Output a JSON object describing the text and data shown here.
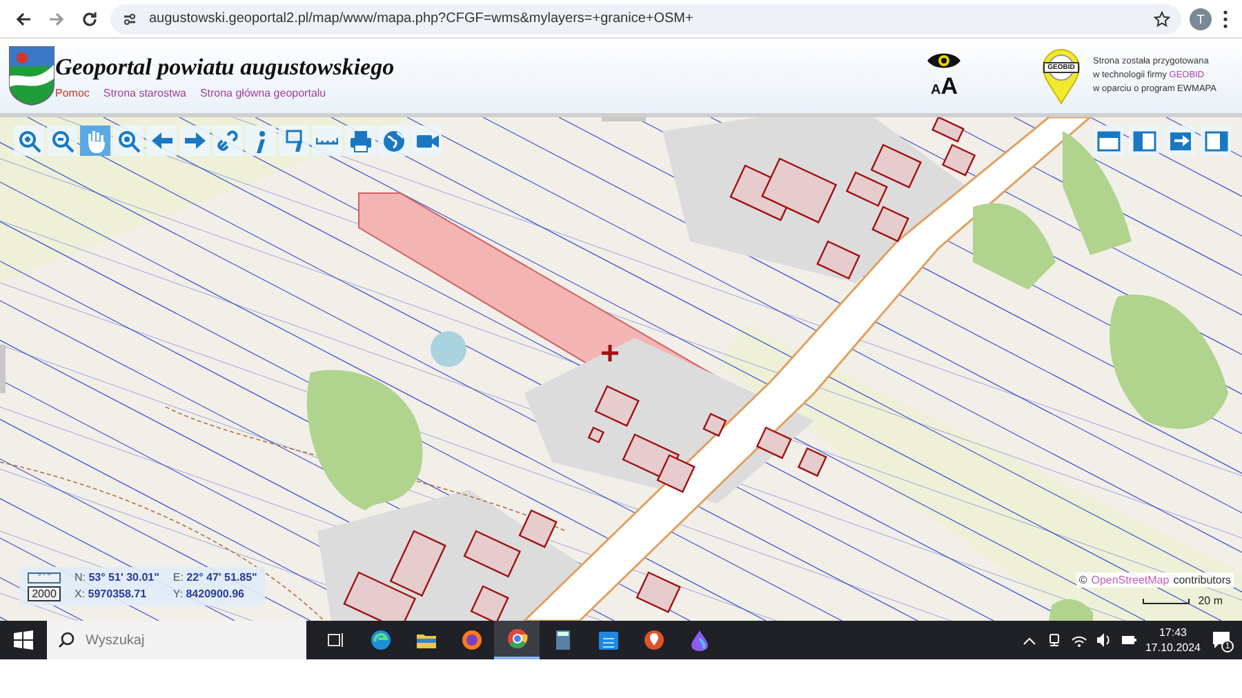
{
  "browser": {
    "url": "augustowski.geoportal2.pl/map/www/mapa.php?CFGF=wms&mylayers=+granice+OSM+",
    "profile": "T"
  },
  "header": {
    "title": "Geoportal powiatu augustowskiego",
    "links": [
      {
        "label": "Pomoc",
        "color": "#c0392b"
      },
      {
        "label": "Strona starostwa",
        "color": "#a0409a"
      },
      {
        "label": "Strona główna geoportalu",
        "color": "#a0409a"
      }
    ],
    "font_sizes": [
      "A",
      "A"
    ],
    "vendor_badge": "GEOBID",
    "notice": {
      "lines": [
        "Strona została przygotowana",
        "w technologii firmy",
        "w oparciu o program EWMAPA"
      ],
      "brand": "GEOBID"
    }
  },
  "toolbar": [
    {
      "kind": "zoom-in",
      "selected": false
    },
    {
      "kind": "zoom-out",
      "selected": false
    },
    {
      "kind": "pan",
      "selected": true
    },
    {
      "kind": "zoom-extent",
      "selected": false
    },
    {
      "kind": "back",
      "selected": false
    },
    {
      "kind": "forward",
      "selected": false
    },
    {
      "kind": "link",
      "selected": false
    },
    {
      "kind": "info",
      "selected": false
    },
    {
      "kind": "info-area",
      "selected": false
    },
    {
      "kind": "measure",
      "selected": false
    },
    {
      "kind": "print",
      "selected": false
    },
    {
      "kind": "globe",
      "selected": false
    },
    {
      "kind": "video",
      "selected": false
    }
  ],
  "panel_buttons": [
    {
      "kind": "top"
    },
    {
      "kind": "left"
    },
    {
      "kind": "export"
    },
    {
      "kind": "right"
    }
  ],
  "coordinates": {
    "format_label": "° ' \"",
    "system_label": "2000",
    "rows": [
      [
        {
          "label": "N:",
          "value": "53° 51' 30.01\""
        },
        {
          "label": "E:",
          "value": "22° 47' 51.85\""
        }
      ],
      [
        {
          "label": "X:",
          "value": "5970358.71"
        },
        {
          "label": "Y:",
          "value": "8420900.96"
        }
      ]
    ]
  },
  "attribution": {
    "symbol": "©",
    "link": "OpenStreetMap",
    "text": "contributors"
  },
  "scale": "20 m",
  "taskbar": {
    "search_placeholder": "Wyszukaj",
    "apps": [
      {
        "kind": "task-view",
        "active": false
      },
      {
        "kind": "edge",
        "active": false
      },
      {
        "kind": "files",
        "active": false
      },
      {
        "kind": "firefox",
        "active": false
      },
      {
        "kind": "chrome",
        "active": true
      },
      {
        "kind": "calculator",
        "active": false
      },
      {
        "kind": "calendar",
        "active": false
      },
      {
        "kind": "maps",
        "active": false
      },
      {
        "kind": "drop",
        "active": false
      }
    ],
    "time": "17:43",
    "date": "17.10.2024",
    "notifications": "1"
  }
}
